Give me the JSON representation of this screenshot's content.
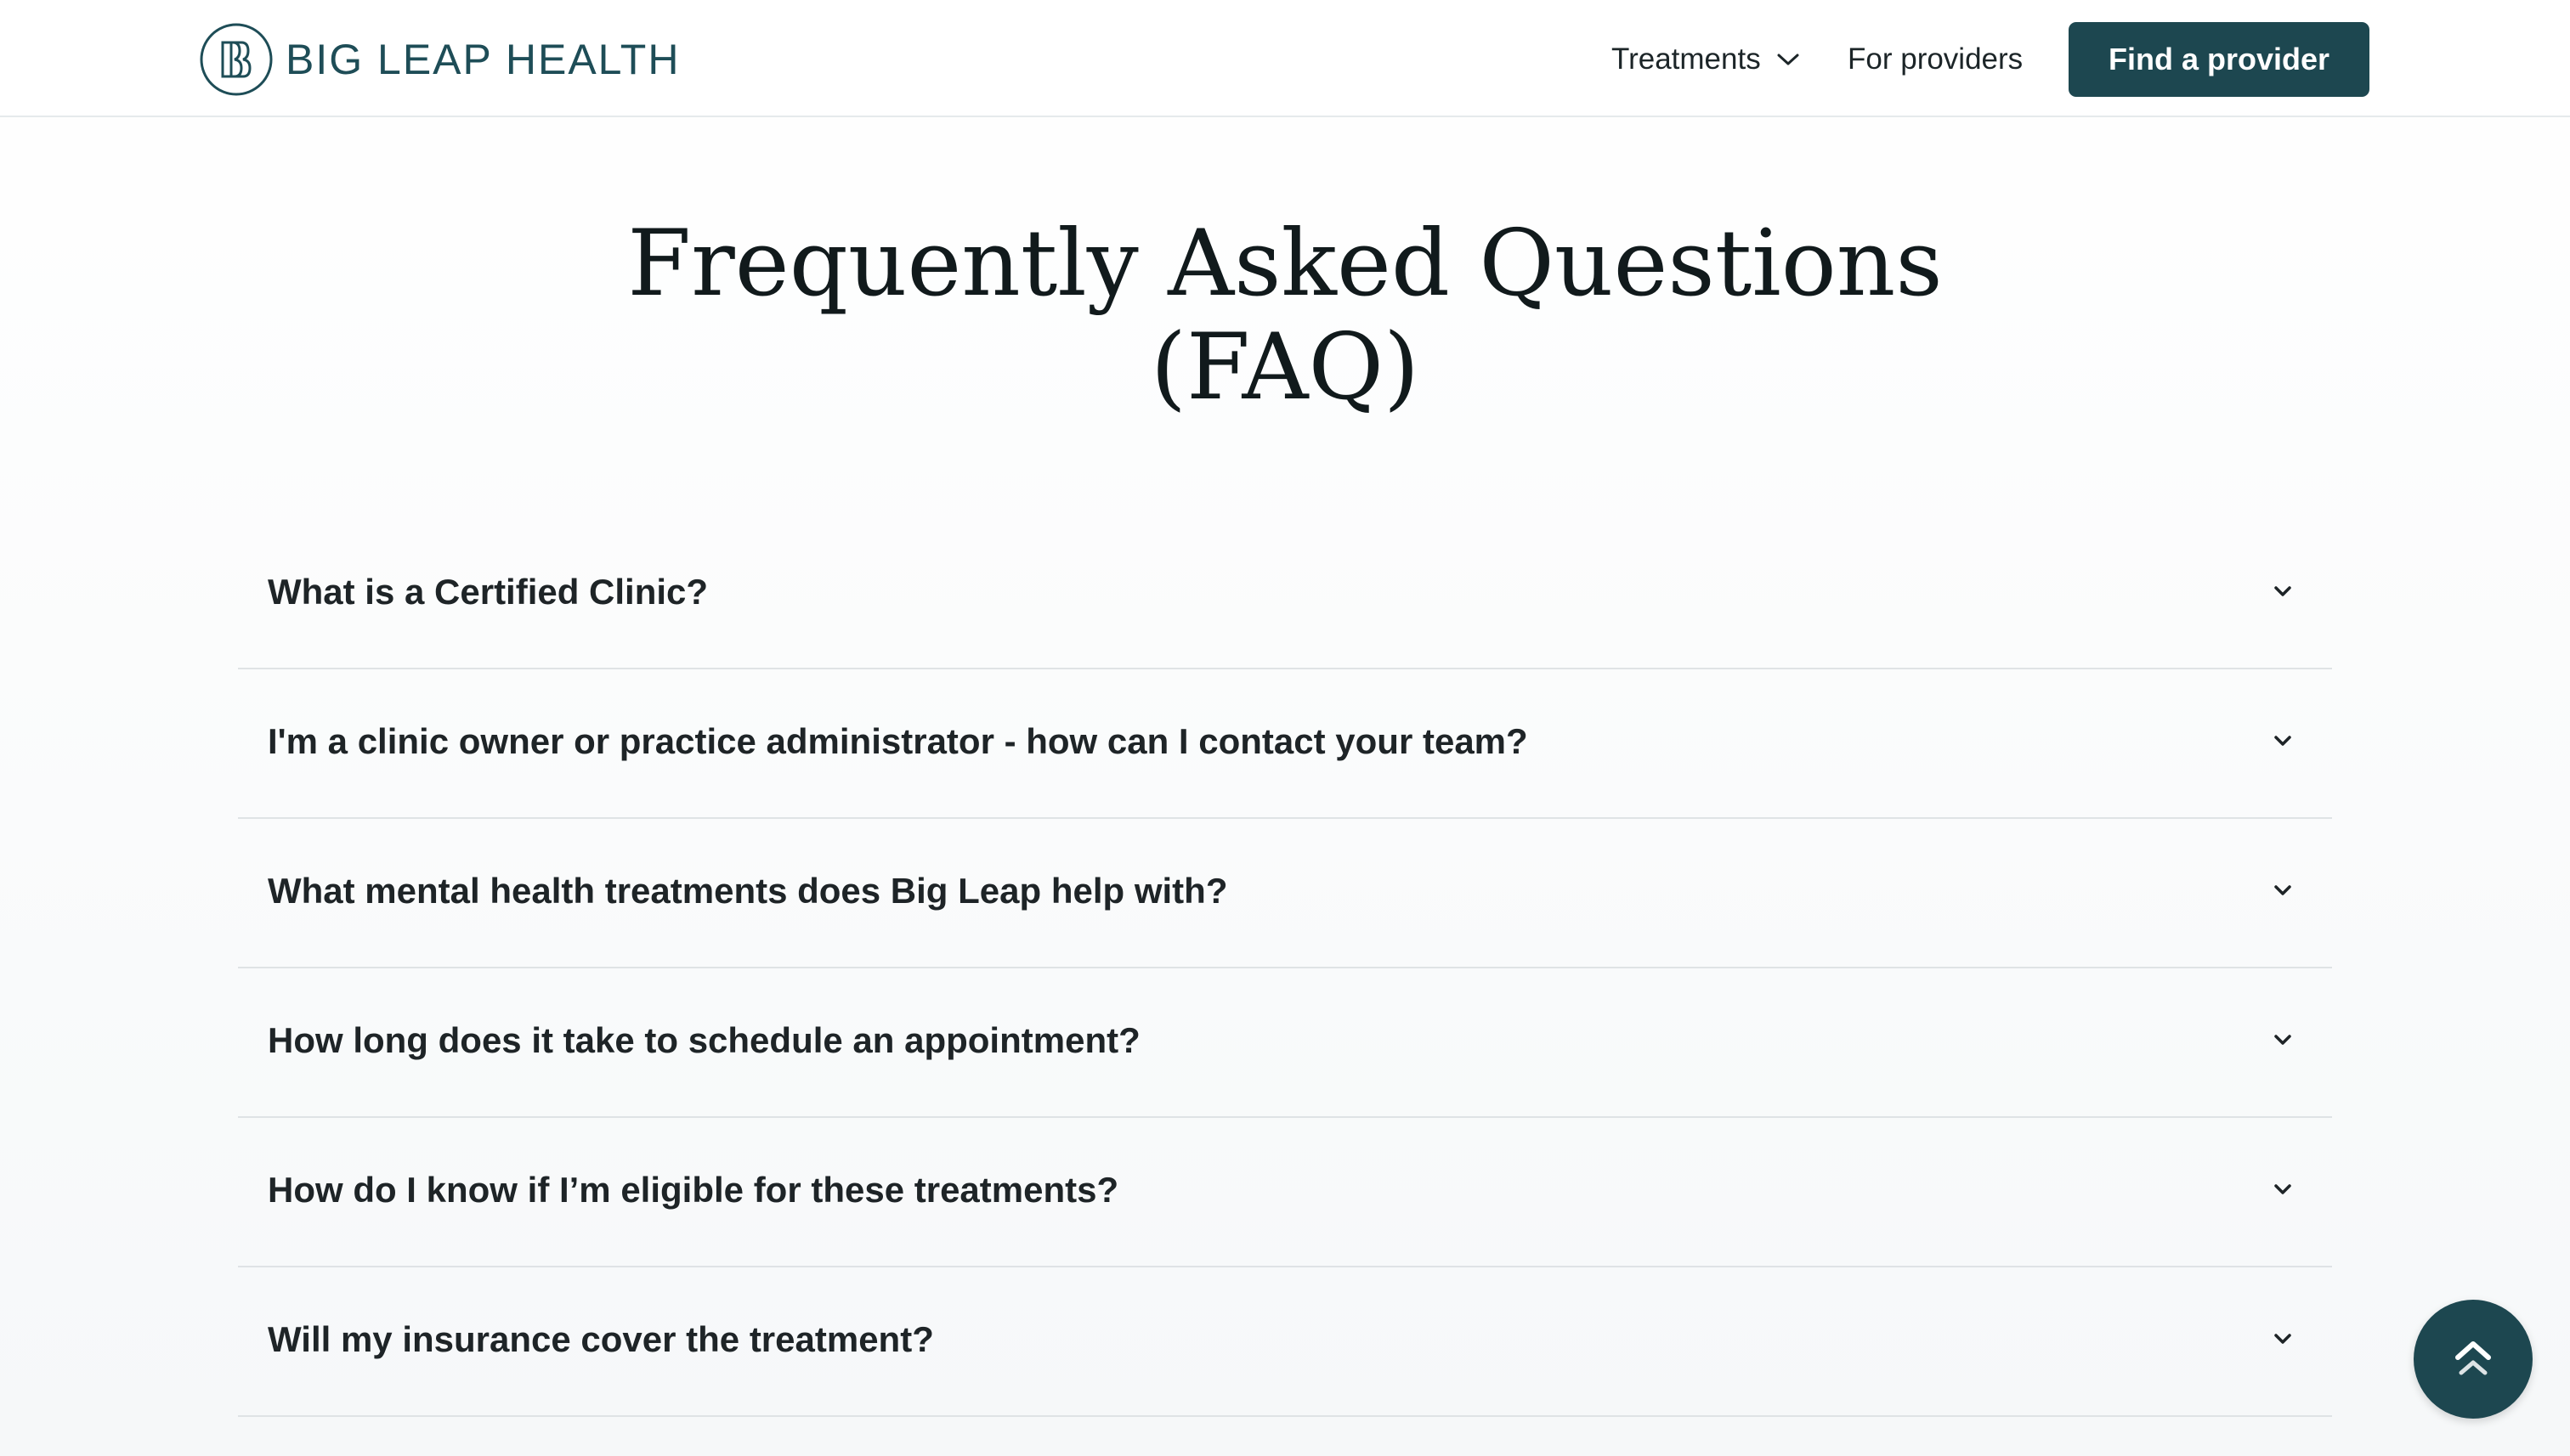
{
  "brand": {
    "name": "BIG LEAP HEALTH",
    "logo_icon": "bl-monogram-icon",
    "color": "#1e4d57"
  },
  "nav": {
    "treatments_label": "Treatments",
    "providers_label": "For providers",
    "cta_label": "Find a provider",
    "cta_color": "#1d4750"
  },
  "faq": {
    "title_line1": "Frequently Asked Questions",
    "title_line2": "(FAQ)",
    "items": [
      {
        "question": "What is a Certified Clinic?"
      },
      {
        "question": "I'm a clinic owner or practice administrator - how can I contact your team?"
      },
      {
        "question": "What mental health treatments does Big Leap help with?"
      },
      {
        "question": "How long does it take to schedule an appointment?"
      },
      {
        "question": "How do I know if I’m eligible for these treatments?"
      },
      {
        "question": "Will my insurance cover the treatment?"
      }
    ]
  },
  "scroll_top": {
    "icon": "double-chevron-up-icon"
  }
}
